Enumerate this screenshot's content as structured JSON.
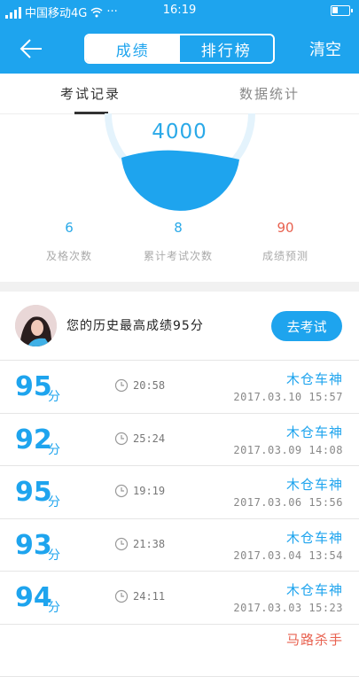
{
  "status_bar": {
    "carrier": "中国移动4G",
    "dots": "···",
    "time": "16:19"
  },
  "header": {
    "tab_score": "成绩",
    "tab_rank": "排行榜",
    "clear": "清空"
  },
  "tabs": {
    "records": "考试记录",
    "stats": "数据统计"
  },
  "summary": {
    "score": "4000",
    "stats": [
      {
        "value": "6",
        "label": "及格次数",
        "color": "#2aa9e8"
      },
      {
        "value": "8",
        "label": "累计考试次数",
        "color": "#2aa9e8"
      },
      {
        "value": "90",
        "label": "成绩预测",
        "color": "#e8614f"
      }
    ]
  },
  "best": {
    "text": "您的历史最高成绩95分",
    "button": "去考试"
  },
  "records": [
    {
      "score": "95",
      "unit": "分",
      "duration": "20:58",
      "name": "木仓车神",
      "date": "2017.03.10  15:57"
    },
    {
      "score": "92",
      "unit": "分",
      "duration": "25:24",
      "name": "木仓车神",
      "date": "2017.03.09  14:08"
    },
    {
      "score": "95",
      "unit": "分",
      "duration": "19:19",
      "name": "木仓车神",
      "date": "2017.03.06  15:56"
    },
    {
      "score": "93",
      "unit": "分",
      "duration": "21:38",
      "name": "木仓车神",
      "date": "2017.03.04  13:54"
    },
    {
      "score": "94",
      "unit": "分",
      "duration": "24:11",
      "name": "木仓车神",
      "date": "2017.03.03  15:23"
    },
    {
      "score": "",
      "unit": "",
      "duration": "",
      "name": "马路杀手",
      "date": ""
    }
  ],
  "colors": {
    "primary": "#1ea4ee",
    "accent_red": "#e8614f"
  }
}
